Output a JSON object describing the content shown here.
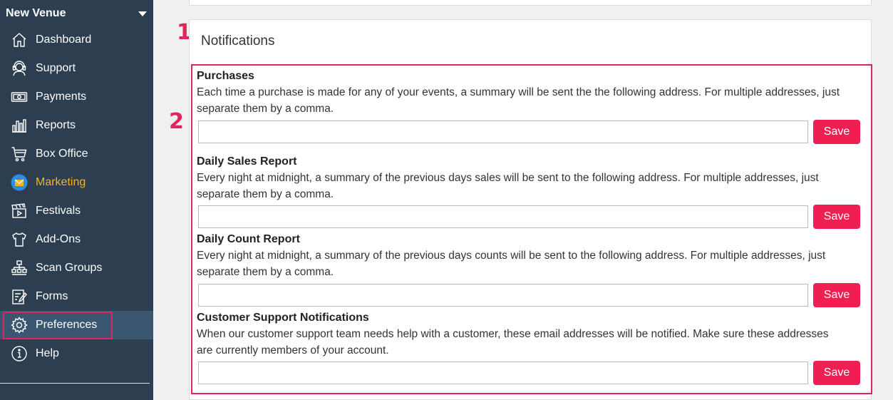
{
  "sidebar": {
    "venue_name": "New Venue",
    "items": [
      {
        "label": "Dashboard",
        "icon": "home-icon"
      },
      {
        "label": "Support",
        "icon": "headset-icon"
      },
      {
        "label": "Payments",
        "icon": "money-icon"
      },
      {
        "label": "Reports",
        "icon": "bar-chart-icon"
      },
      {
        "label": "Box Office",
        "icon": "cart-icon"
      },
      {
        "label": "Marketing",
        "icon": "envelope-icon"
      },
      {
        "label": "Festivals",
        "icon": "clapperboard-icon"
      },
      {
        "label": "Add-Ons",
        "icon": "tshirt-icon"
      },
      {
        "label": "Scan Groups",
        "icon": "hierarchy-icon"
      },
      {
        "label": "Forms",
        "icon": "form-edit-icon"
      },
      {
        "label": "Preferences",
        "icon": "gear-icon"
      },
      {
        "label": "Help",
        "icon": "info-icon"
      }
    ],
    "active_item": "Preferences",
    "marketing_color": "#f5b323"
  },
  "markers": {
    "one": "1",
    "two": "2"
  },
  "notifications": {
    "title": "Notifications",
    "sections": [
      {
        "title": "Purchases",
        "desc_line1": "Each time a purchase is made for any of your events, a summary will be sent the the following address. For multiple addresses, just",
        "desc_line2": "separate them by a comma.",
        "value": "",
        "save_label": "Save"
      },
      {
        "title": "Daily Sales Report",
        "desc_line1": "Every night at midnight, a summary of the previous days sales will be sent to the following address. For multiple addresses, just",
        "desc_line2": "separate them by a comma.",
        "value": "",
        "save_label": "Save"
      },
      {
        "title": "Daily Count Report",
        "desc_line1": "Every night at midnight, a summary of the previous days counts will be sent to the following address. For multiple addresses, just",
        "desc_line2": "separate them by a comma.",
        "value": "",
        "save_label": "Save"
      },
      {
        "title": "Customer Support Notifications",
        "desc_line1": "When our customer support team needs help with a customer, these email addresses will be notified. Make sure these addresses",
        "desc_line2": "are currently members of your account.",
        "value": "",
        "save_label": "Save"
      }
    ]
  },
  "colors": {
    "sidebar_bg": "#2c3e50",
    "accent": "#e0245e",
    "save_button": "#ef1f53"
  }
}
